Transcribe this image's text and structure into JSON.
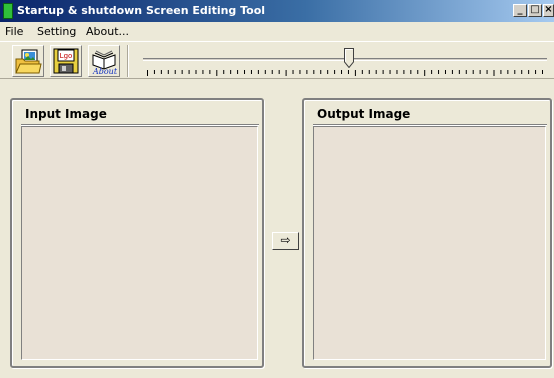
{
  "window": {
    "title": "Startup & shutdown Screen Editing Tool",
    "icon": "app-icon",
    "controls": {
      "minimize": "_",
      "maximize": "□",
      "close": "×"
    }
  },
  "menu": {
    "items": [
      {
        "label": "File"
      },
      {
        "label": "Setting"
      },
      {
        "label": "About..."
      }
    ]
  },
  "toolbar": {
    "buttons": [
      {
        "icon": "open-image-icon"
      },
      {
        "icon": "save-logo-icon",
        "caption": "Lgo"
      },
      {
        "icon": "about-book-icon",
        "caption": "About"
      }
    ],
    "slider": {
      "value_fraction": 0.51,
      "tick_count": 58
    }
  },
  "panels": {
    "input": {
      "title": "Input Image"
    },
    "output": {
      "title": "Output Image"
    }
  },
  "convert_button": {
    "glyph": "⇨"
  },
  "colors": {
    "window_bg": "#ece9d8",
    "image_bg": "#e9e1d6",
    "titlebar_start": "#0a246a",
    "titlebar_end": "#a6caf0"
  }
}
